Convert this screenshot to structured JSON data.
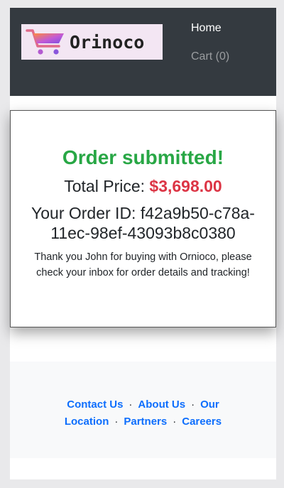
{
  "brand": {
    "name": "Orinoco",
    "logo_icon": "shopping-cart-icon"
  },
  "nav": {
    "home": "Home",
    "cart": "Cart (0)"
  },
  "order": {
    "title": "Order submitted!",
    "price_label": "Total Price:",
    "price_value": "$3,698.00",
    "id_label": "Your Order ID:",
    "id_value": "f42a9b50-c78a-11ec-98ef-43093b8c0380",
    "thanks": "Thank you John for buying with Ornioco, please check your inbox for order details and tracking!"
  },
  "footer": {
    "links": [
      "Contact Us",
      "About Us",
      "Our Location",
      "Partners",
      "Careers"
    ],
    "separator": "·"
  },
  "colors": {
    "navbar": "#343a40",
    "success": "#28a745",
    "price": "#dc3545",
    "link": "#0d6efd",
    "footer_bg": "#f8f9fa"
  }
}
